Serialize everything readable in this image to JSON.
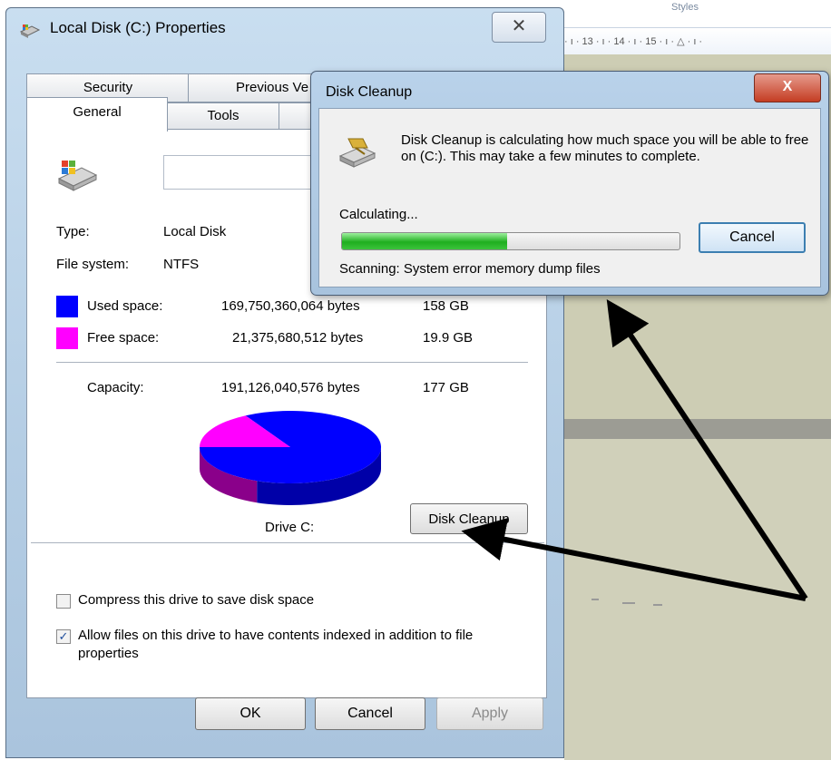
{
  "background": {
    "ruler_text": "· ı · 13 · ı · 14 · ı · 15 · ı · △ · ı ·",
    "styles_label": "Styles"
  },
  "properties_window": {
    "title": "Local Disk (C:) Properties",
    "close_glyph": "✕",
    "tabs": {
      "security": "Security",
      "previous_versions": "Previous Ve",
      "general": "General",
      "tools": "Tools"
    },
    "type_label": "Type:",
    "type_value": "Local Disk",
    "fs_label": "File system:",
    "fs_value": "NTFS",
    "used_label": "Used space:",
    "used_bytes": "169,750,360,064 bytes",
    "used_gb": "158 GB",
    "free_label": "Free space:",
    "free_bytes": "21,375,680,512 bytes",
    "free_gb": "19.9 GB",
    "capacity_label": "Capacity:",
    "capacity_bytes": "191,126,040,576 bytes",
    "capacity_gb": "177 GB",
    "drive_label": "Drive C:",
    "disk_cleanup_button": "Disk Cleanup",
    "compress_label": "Compress this drive to save disk space",
    "compress_checked": false,
    "index_label": "Allow files on this drive to have contents indexed in addition to file properties",
    "index_checked": true,
    "ok_button": "OK",
    "cancel_button": "Cancel",
    "apply_button": "Apply",
    "colors": {
      "used": "#0000ff",
      "free": "#ff00ff"
    },
    "used_fraction": 0.888
  },
  "cleanup_dialog": {
    "title": "Disk Cleanup",
    "close_glyph": "X",
    "message": "Disk Cleanup is calculating how much space you will be able to free on  (C:). This may take a few minutes to complete.",
    "calculating_label": "Calculating...",
    "progress_fraction": 0.49,
    "cancel_button": "Cancel",
    "scanning_text": "Scanning:  System error memory dump files"
  }
}
